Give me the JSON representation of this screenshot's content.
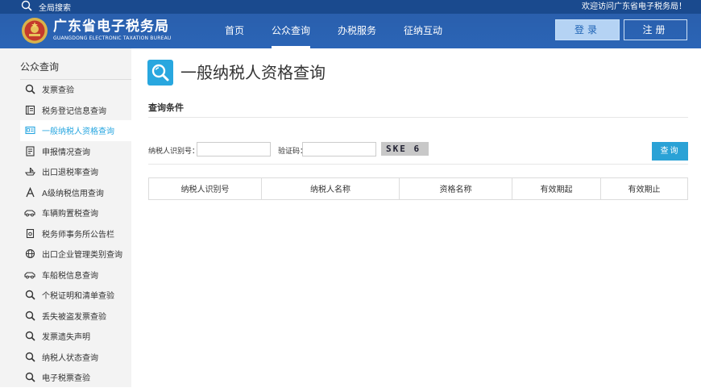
{
  "topbar": {
    "search_label": "全局搜索",
    "welcome": "欢迎访问广东省电子税务局！"
  },
  "header": {
    "brand_cn": "广东省电子税务局",
    "brand_en": "GUANGDONG ELECTRONIC TAXATION BUREAU",
    "nav": [
      {
        "label": "首页",
        "active": false
      },
      {
        "label": "公众查询",
        "active": true
      },
      {
        "label": "办税服务",
        "active": false
      },
      {
        "label": "征纳互动",
        "active": false
      }
    ],
    "login_label": "登录",
    "register_label": "注册"
  },
  "sidebar": {
    "title": "公众查询",
    "items": [
      {
        "label": "发票查验",
        "icon": "search-icon",
        "active": false
      },
      {
        "label": "税务登记信息查询",
        "icon": "book-icon",
        "active": false
      },
      {
        "label": "一般纳税人资格查询",
        "icon": "id-card-icon",
        "active": true
      },
      {
        "label": "申报情况查询",
        "icon": "document-icon",
        "active": false
      },
      {
        "label": "出口退税率查询",
        "icon": "ship-icon",
        "active": false
      },
      {
        "label": "A级纳税信用查询",
        "icon": "a-grade-icon",
        "active": false
      },
      {
        "label": "车辆购置税查询",
        "icon": "car-icon",
        "active": false
      },
      {
        "label": "税务师事务所公告栏",
        "icon": "notice-icon",
        "active": false
      },
      {
        "label": "出口企业管理类别查询",
        "icon": "globe-icon",
        "active": false
      },
      {
        "label": "车船税信息查询",
        "icon": "car-icon",
        "active": false
      },
      {
        "label": "个税证明和清单查验",
        "icon": "search-icon",
        "active": false
      },
      {
        "label": "丢失被盗发票查验",
        "icon": "search-icon",
        "active": false
      },
      {
        "label": "发票遗失声明",
        "icon": "search-icon",
        "active": false
      },
      {
        "label": "纳税人状态查询",
        "icon": "search-icon",
        "active": false
      },
      {
        "label": "电子税票查验",
        "icon": "search-icon",
        "active": false
      }
    ]
  },
  "main": {
    "page_title": "一般纳税人资格查询",
    "section_title": "查询条件",
    "form": {
      "taxpayer_id_label": "纳税人识别号：",
      "taxpayer_id_value": "",
      "captcha_label": "验证码：",
      "captcha_value": "",
      "captcha_image_text": "SKE 6",
      "query_label": "查询"
    },
    "table": {
      "columns": [
        "纳税人识别号",
        "纳税人名称",
        "资格名称",
        "有效期起",
        "有效期止"
      ]
    }
  },
  "colors": {
    "topbar": "#1a4a8e",
    "header": "#2b65b6",
    "accent": "#28a7df",
    "sidebar_bg": "#f3f3f3"
  }
}
